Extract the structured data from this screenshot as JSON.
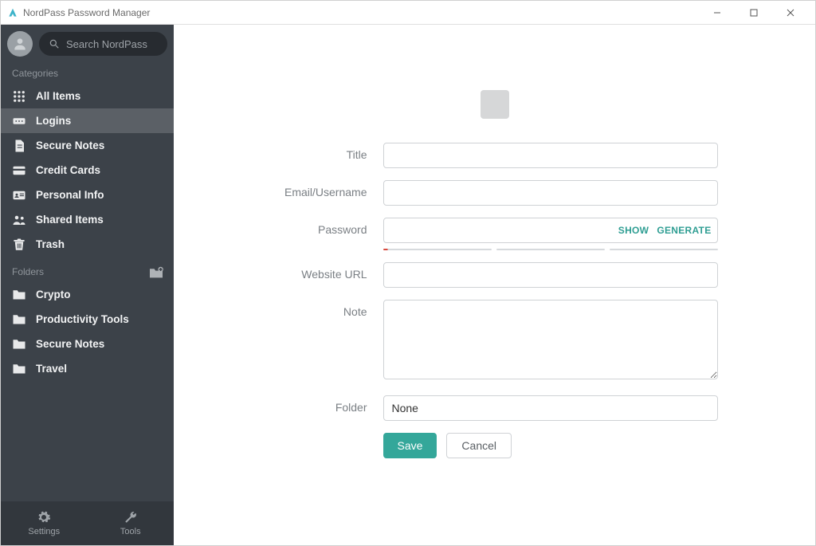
{
  "window": {
    "title": "NordPass Password Manager"
  },
  "search": {
    "placeholder": "Search NordPass"
  },
  "sidebar": {
    "sections": {
      "categories_label": "Categories",
      "folders_label": "Folders"
    },
    "categories": [
      {
        "id": "all",
        "label": "All Items"
      },
      {
        "id": "logins",
        "label": "Logins",
        "active": true
      },
      {
        "id": "notes",
        "label": "Secure Notes"
      },
      {
        "id": "cards",
        "label": "Credit Cards"
      },
      {
        "id": "personal",
        "label": "Personal Info"
      },
      {
        "id": "shared",
        "label": "Shared Items"
      },
      {
        "id": "trash",
        "label": "Trash"
      }
    ],
    "folders": [
      {
        "label": "Crypto"
      },
      {
        "label": "Productivity Tools"
      },
      {
        "label": "Secure Notes"
      },
      {
        "label": "Travel"
      }
    ],
    "bottom": {
      "settings": "Settings",
      "tools": "Tools"
    }
  },
  "form": {
    "labels": {
      "title": "Title",
      "username": "Email/Username",
      "password": "Password",
      "website": "Website URL",
      "note": "Note",
      "folder": "Folder"
    },
    "values": {
      "title": "",
      "username": "",
      "password": "",
      "website": "",
      "note": "",
      "folder": "None"
    },
    "password_actions": {
      "show": "SHOW",
      "generate": "GENERATE"
    },
    "buttons": {
      "save": "Save",
      "cancel": "Cancel"
    }
  }
}
